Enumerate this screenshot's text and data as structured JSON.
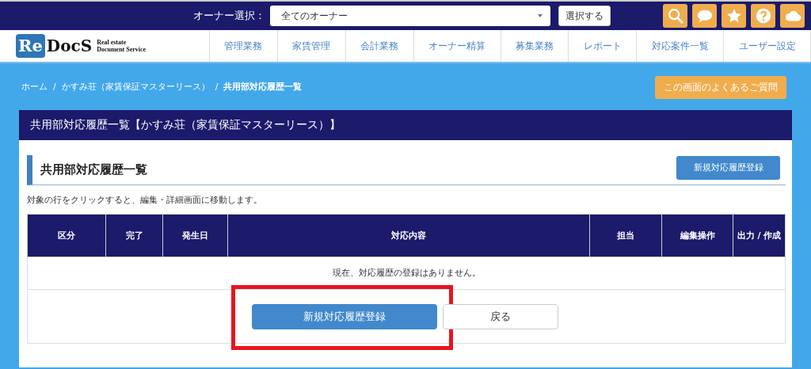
{
  "top_bar": {
    "owner_label": "オーナー選択：",
    "owner_select": {
      "value": "全てのオーナー"
    },
    "select_button": "選択する",
    "icons": [
      {
        "kind": "search"
      },
      {
        "kind": "chat"
      },
      {
        "kind": "star"
      },
      {
        "kind": "help"
      },
      {
        "kind": "cloud"
      }
    ]
  },
  "logo": {
    "mark": "Re",
    "name": "DocS",
    "tagline": [
      "Real estate",
      "Document Service"
    ]
  },
  "nav": [
    "管理業務",
    "家賃管理",
    "会計業務",
    "オーナー精算",
    "募集業務",
    "レポート",
    "対応案件一覧",
    "ユーザー設定"
  ],
  "breadcrumb": [
    {
      "label": "ホーム",
      "current": false
    },
    {
      "separator": "/",
      "label": "かすみ荘（家賃保証マスターリース）",
      "current": false
    },
    {
      "separator": "/",
      "label": "共用部対応履歴一覧",
      "current": true
    }
  ],
  "faq_button": "この画面のよくあるご質問",
  "panel": {
    "title": "共用部対応履歴一覧【かすみ荘（家賃保証マスターリース）】",
    "section_title": "共用部対応履歴一覧",
    "new_button": "新規対応履歴登録",
    "note": "対象の行をクリックすると、編集・詳細画面に移動します。",
    "table": {
      "columns": [
        "区分",
        "完了",
        "発生日",
        "対応内容",
        "担当",
        "編集操作",
        "出力 / 作成"
      ],
      "empty_message": "現在、対応履歴の登録はありません。"
    },
    "actions": [
      {
        "label": "新規対応履歴登録",
        "kind": "primary",
        "highlighted": true
      },
      {
        "label": "戻る",
        "kind": "secondary",
        "highlighted": false
      }
    ]
  }
}
